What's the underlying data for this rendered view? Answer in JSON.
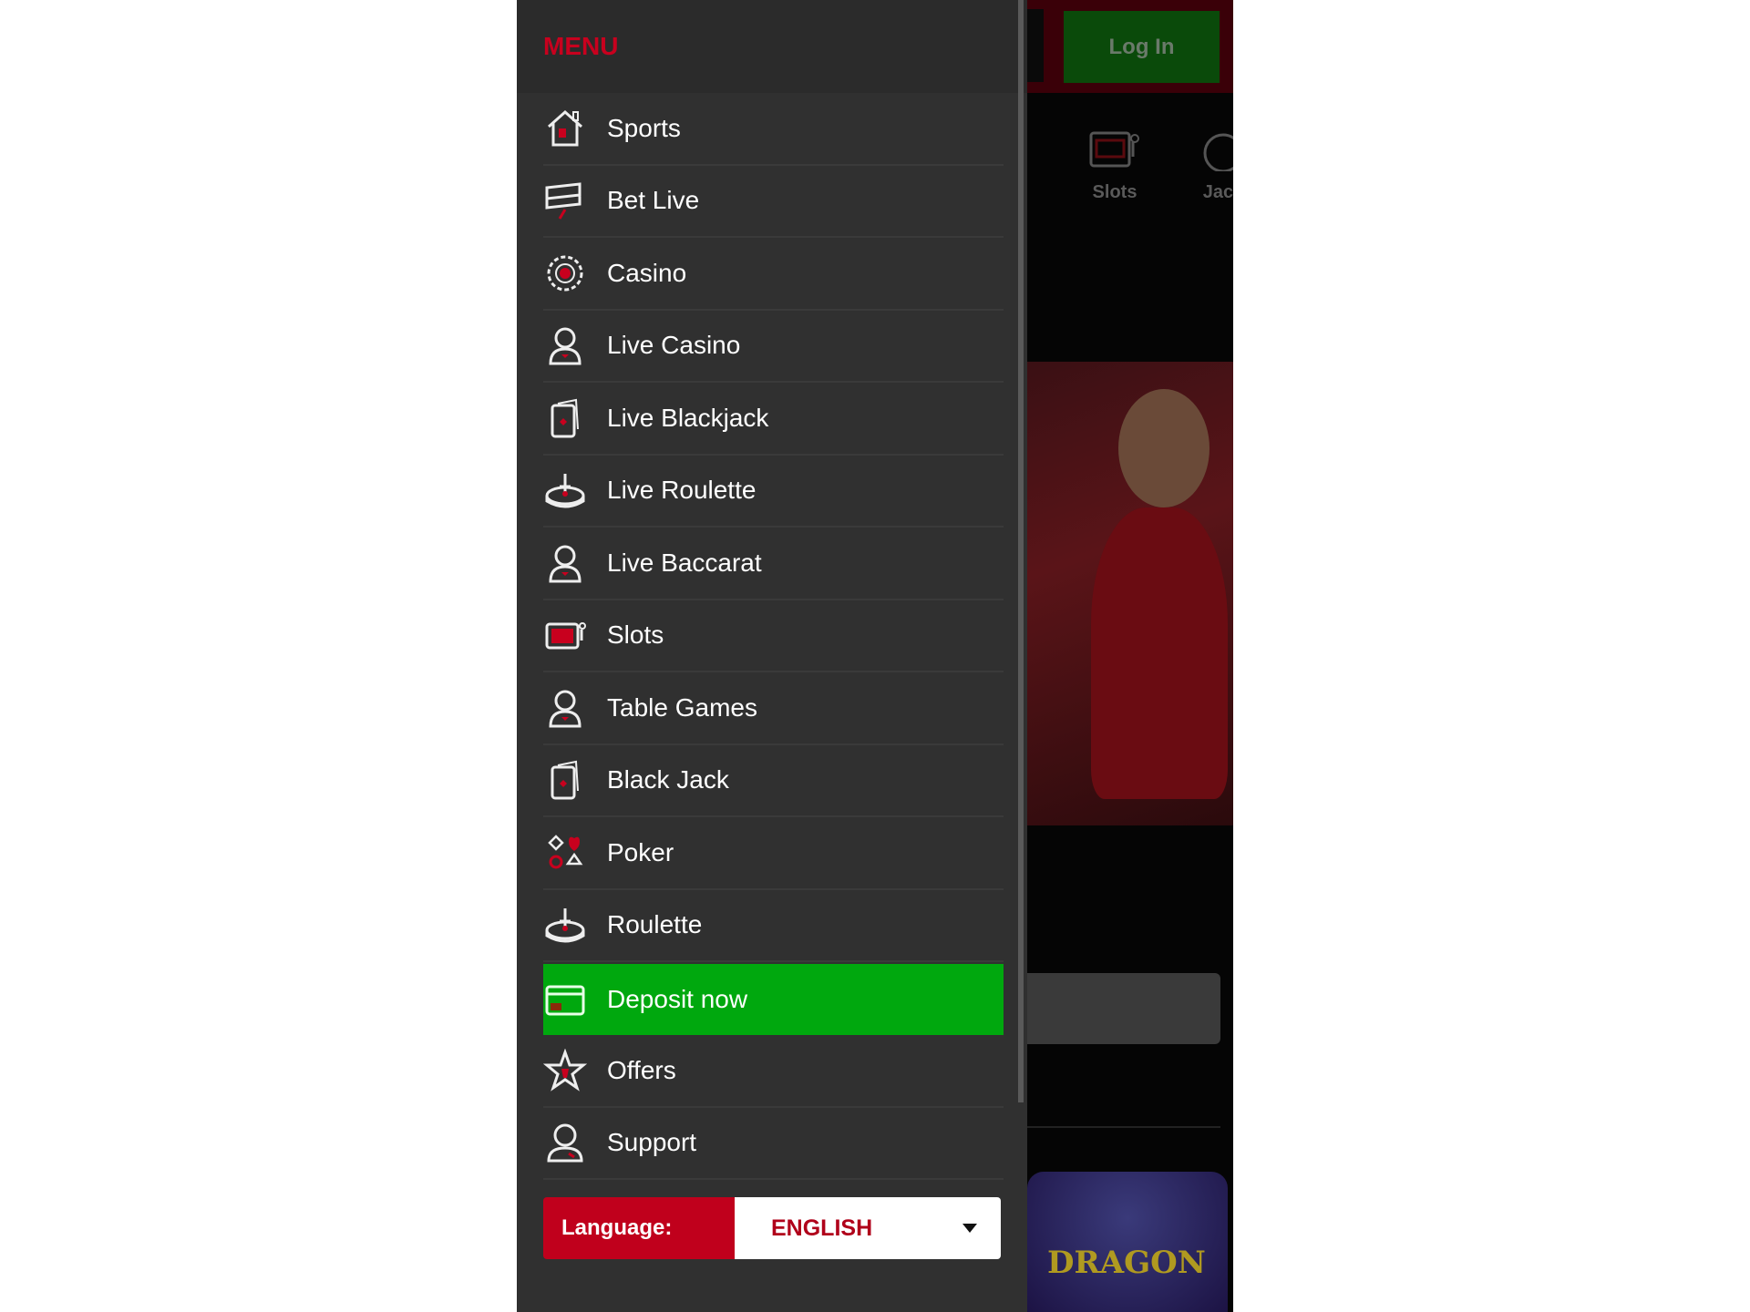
{
  "menu": {
    "title": "MENU",
    "items": [
      {
        "label": "Sports",
        "icon": "house-icon"
      },
      {
        "label": "Bet Live",
        "icon": "tickets-icon"
      },
      {
        "label": "Casino",
        "icon": "chip-icon"
      },
      {
        "label": "Live Casino",
        "icon": "dealer-icon"
      },
      {
        "label": "Live Blackjack",
        "icon": "card-icon"
      },
      {
        "label": "Live Roulette",
        "icon": "roulette-icon"
      },
      {
        "label": "Live Baccarat",
        "icon": "dealer-icon"
      },
      {
        "label": "Slots",
        "icon": "slot-machine-icon"
      },
      {
        "label": "Table Games",
        "icon": "dealer-icon"
      },
      {
        "label": "Black Jack",
        "icon": "card-icon"
      },
      {
        "label": "Poker",
        "icon": "card-suits-icon"
      },
      {
        "label": "Roulette",
        "icon": "roulette-icon"
      },
      {
        "label": "Deposit now",
        "icon": "credit-card-icon",
        "highlight": true
      },
      {
        "label": "Offers",
        "icon": "star-icon"
      },
      {
        "label": "Support",
        "icon": "support-agent-icon"
      }
    ],
    "language": {
      "label": "Language:",
      "value": "ENGLISH"
    }
  },
  "background": {
    "login_label": "Log In",
    "categories": [
      "Slots",
      "Jack"
    ],
    "game_title": "DRAGON"
  },
  "colors": {
    "accent_red": "#c8001e",
    "deposit_green": "#00a80e",
    "panel": "#303030"
  }
}
